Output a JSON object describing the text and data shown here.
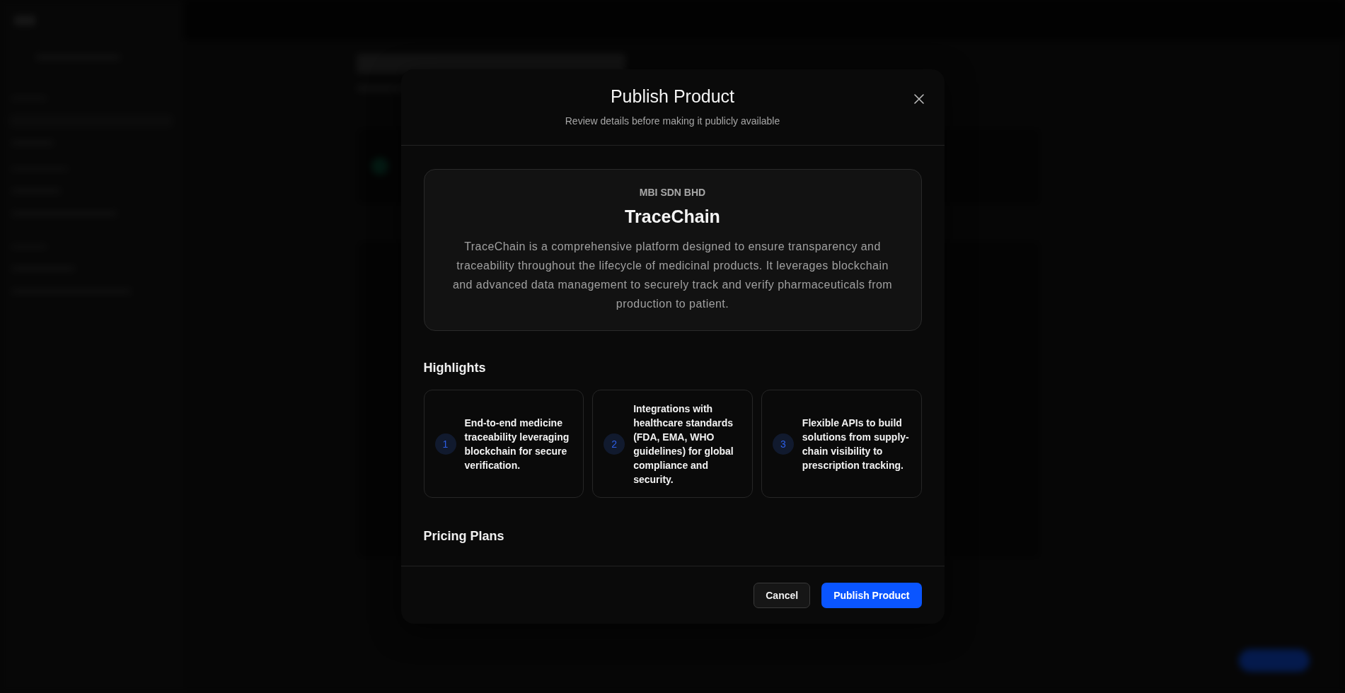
{
  "modal": {
    "title": "Publish Product",
    "subtitle": "Review details before making it publicly available"
  },
  "product": {
    "company": "MBI SDN BHD",
    "name": "TraceChain",
    "description": "TraceChain is a comprehensive platform designed to ensure transparency and traceability throughout the lifecycle of medicinal products. It leverages blockchain and advanced data management to securely track and verify pharmaceuticals from production to patient."
  },
  "highlights_title": "Highlights",
  "highlights": [
    {
      "number": "1",
      "text": "End-to-end medicine traceability leveraging blockchain for secure verification."
    },
    {
      "number": "2",
      "text": "Integrations with healthcare standards (FDA, EMA, WHO guidelines) for global compliance and security."
    },
    {
      "number": "3",
      "text": "Flexible APIs to build solutions from supply-chain visibility to prescription tracking."
    }
  ],
  "pricing_title": "Pricing Plans",
  "buttons": [
    {
      "label": "Cancel",
      "kind": "secondary"
    },
    {
      "label": "Publish Product",
      "kind": "primary"
    }
  ]
}
